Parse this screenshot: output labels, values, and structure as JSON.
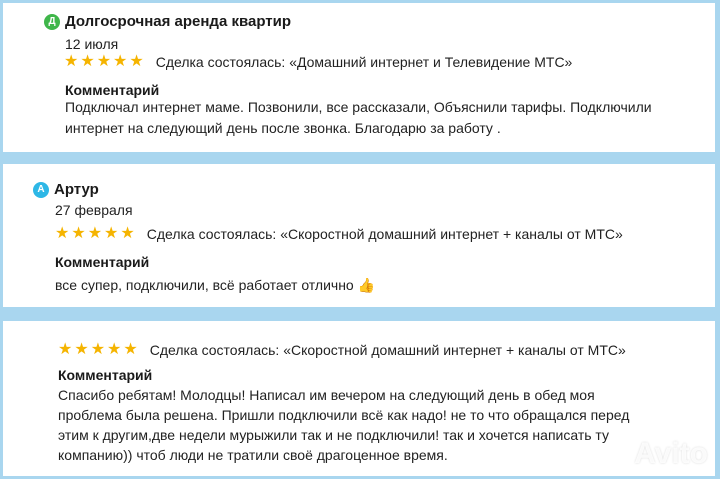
{
  "reviews": [
    {
      "avatar_letter": "Д",
      "avatar_color": "#3fb64a",
      "name": "Долгосрочная аренда квартир",
      "date": "12 июля",
      "stars": "★★★★★",
      "rating": 5,
      "deal": "Сделка состоялась: «Домашний интернет и Телевидение МТС»",
      "comment_title": "Комментарий",
      "comment": "Подключал интернет маме. Позвонили, все рассказали, Объяснили тарифы. Подключили интернет на следующий день после звонка. Благодарю за работу ."
    },
    {
      "avatar_letter": "А",
      "avatar_color": "#2db7e6",
      "name": "Артур",
      "date": "27 февраля",
      "stars": "★★★★★",
      "rating": 5,
      "deal": "Сделка состоялась: «Скоростной домашний интернет + каналы от МТС»",
      "comment_title": "Комментарий",
      "comment": "все супер, подключили, всё работает отлично",
      "emoji": "👍"
    },
    {
      "stars": "★★★★★",
      "rating": 5,
      "deal": "Сделка состоялась: «Скоростной домашний интернет + каналы от МТС»",
      "comment_title": "Комментарий",
      "comment": "Спасибо ребятам! Молодцы! Написал им вечером на следующий день в обед моя проблема была решена. Пришли подключили всё как надо! не то что обращался перед этим к другим,две недели мурыжили так и не подключили! так и хочется написать ту компанию)) чтоб люди не тратили своё драгоценное время."
    }
  ],
  "watermark": "Avito",
  "colors": {
    "background": "#a9d6ef",
    "star": "#f5b400"
  }
}
